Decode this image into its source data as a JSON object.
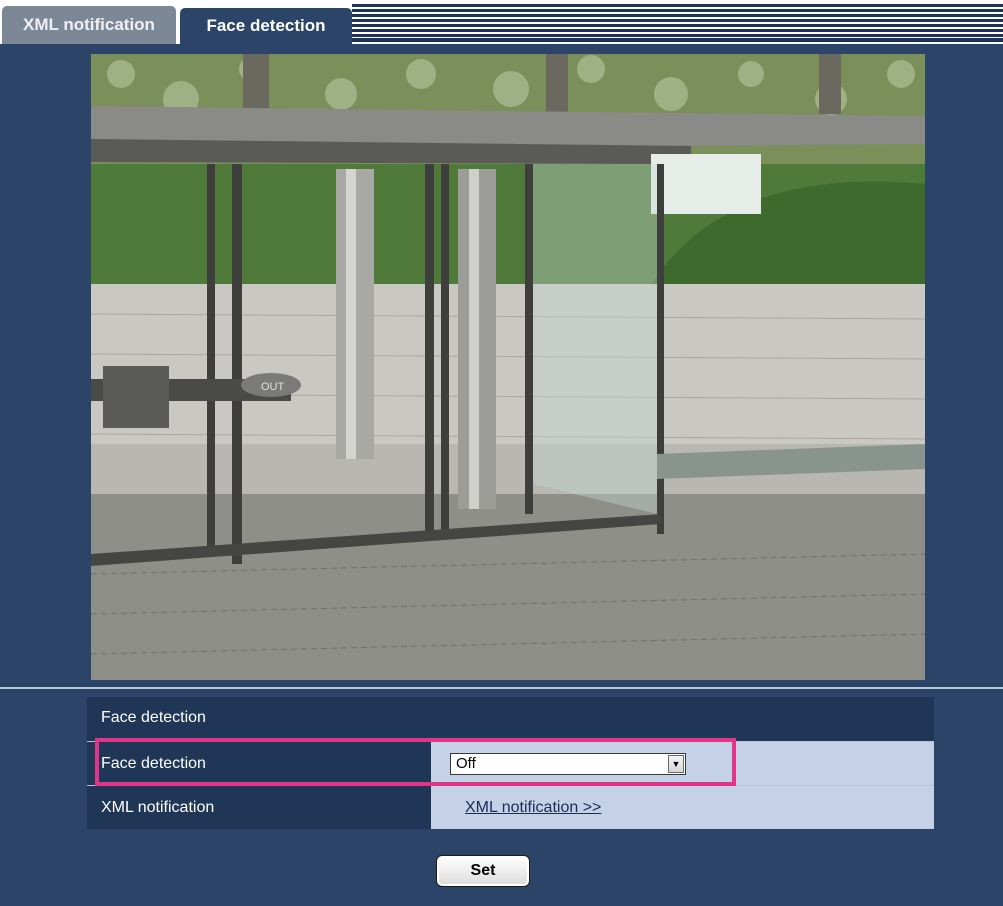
{
  "tabs": {
    "xml_notification": "XML notification",
    "face_detection": "Face detection"
  },
  "settings": {
    "section_title": "Face detection",
    "face_detection_label": "Face detection",
    "face_detection_value": "Off",
    "xml_notification_label": "XML notification",
    "xml_notification_link": "XML notification >>"
  },
  "buttons": {
    "set": "Set"
  },
  "camera_sign_text": "OUT",
  "colors": {
    "page_bg": "#2b4468",
    "header_row": "#1f3657",
    "value_cell": "#c4d1e6",
    "highlight": "#e2358a"
  }
}
